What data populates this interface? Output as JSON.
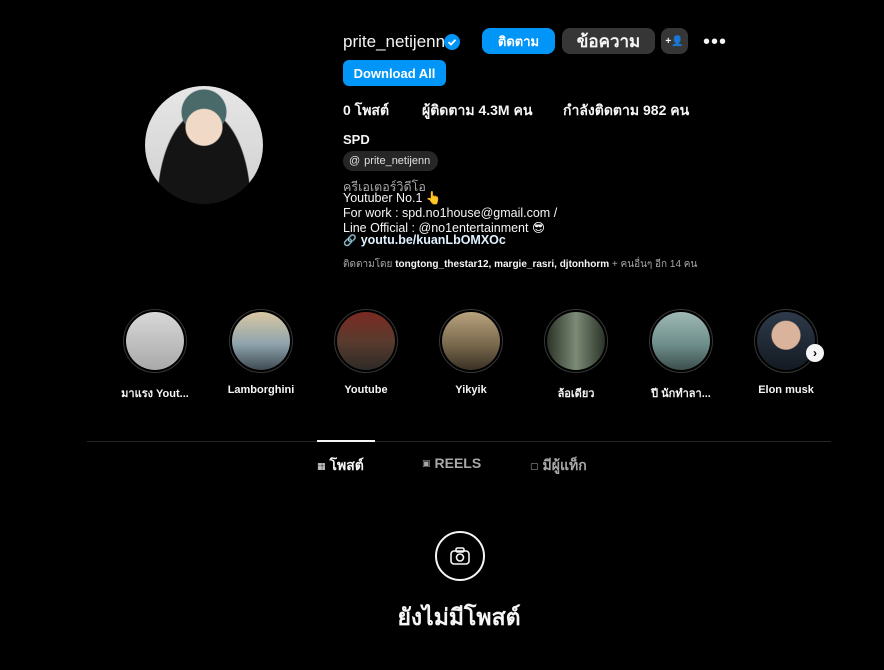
{
  "profile": {
    "username": "prite_netijenn",
    "follow_label": "ติดตาม",
    "message_label": "ข้อความ",
    "add_user_label": "+👤",
    "download_label": "Download All",
    "stats": {
      "posts": "0 โพสต์",
      "followers": "ผู้ติดตาม 4.3M คน",
      "following": "กำลังติดตาม 982 คน"
    },
    "full_name": "SPD",
    "threads_handle": "prite_netijenn",
    "bio": {
      "category": "ครีเอเตอร์วิดีโอ",
      "line1": "Youtuber No.1 👆",
      "line2": "For work : spd.no1house@gmail.com /",
      "line3": "Line Official : @no1entertainment 😎",
      "link": "youtu.be/kuanLbOMXOc"
    },
    "followed_by": {
      "prefix": "ติดตามโดย ",
      "names": "tongtong_thestar12, margie_rasri, djtonhorm",
      "suffix": " + คนอื่นๆ อีก 14 คน"
    }
  },
  "highlights": [
    {
      "label": "มาแรง Yout...",
      "color": "#c9c9c9"
    },
    {
      "label": "Lamborghini",
      "color": "#8fa4ad"
    },
    {
      "label": "Youtube",
      "color": "#5a3b2e"
    },
    {
      "label": "Yikyik",
      "color": "#7a6a4e"
    },
    {
      "label": "ล้อเดียว",
      "color": "#4b5a4a"
    },
    {
      "label": "ปี นักทำลา...",
      "color": "#6f8f8c"
    },
    {
      "label": "Elon musk",
      "color": "#2e3a4a"
    }
  ],
  "tabs": {
    "posts": "โพสต์",
    "reels": "REELS",
    "tagged": "มีผู้แท็ก"
  },
  "empty_state": {
    "title": "ยังไม่มีโพสต์"
  },
  "colors": {
    "accent": "#0095f6",
    "background": "#000000",
    "secondary_button": "#363636"
  }
}
